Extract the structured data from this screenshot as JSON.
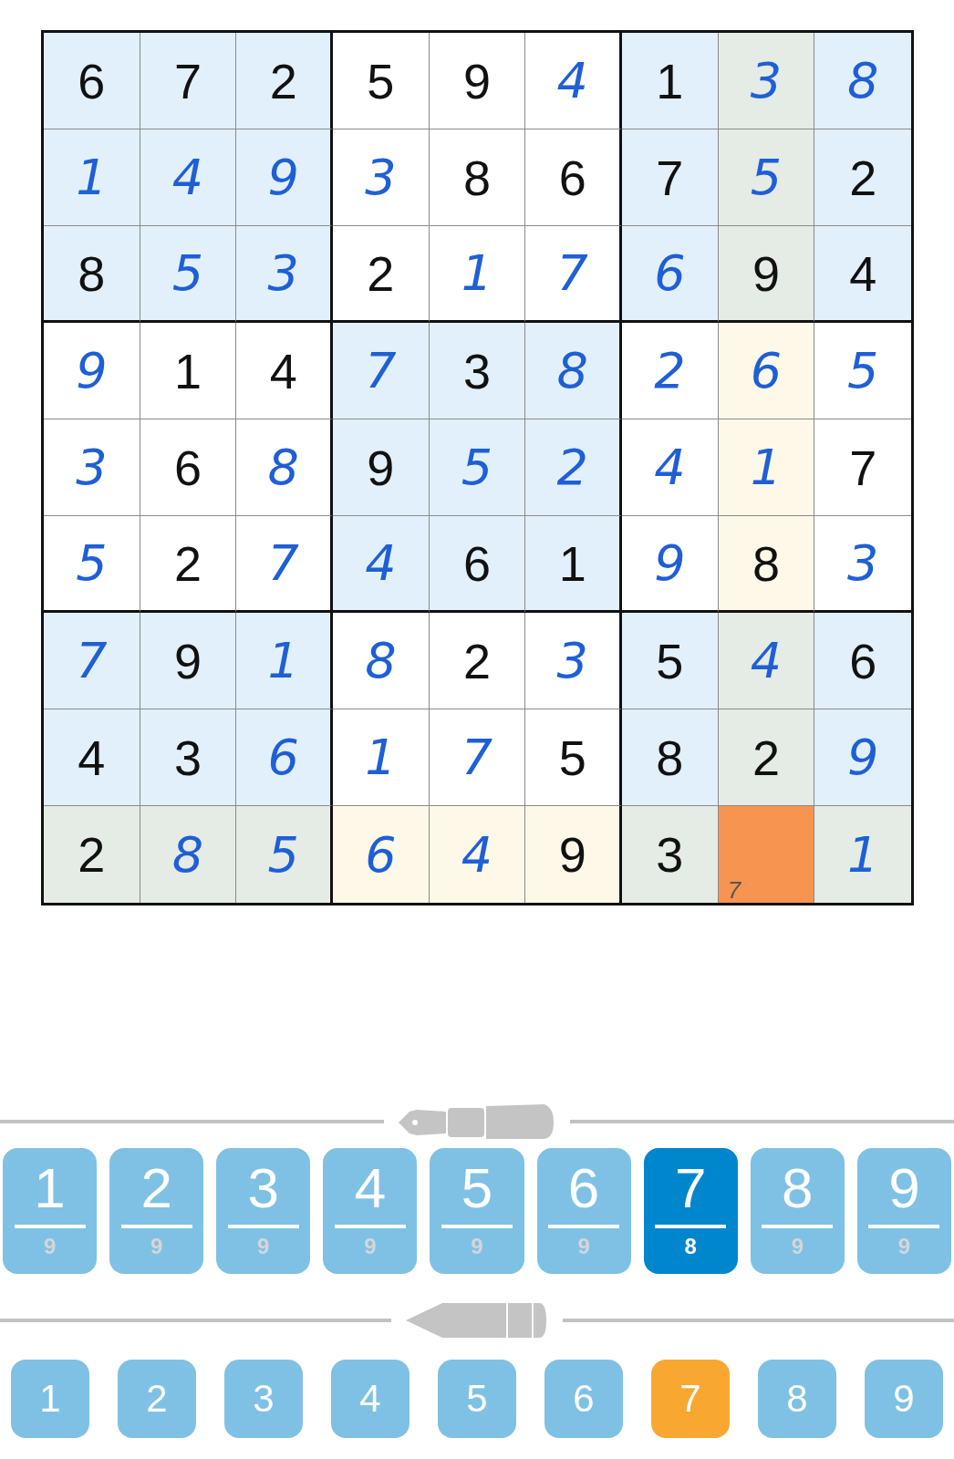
{
  "grid": [
    [
      {
        "value": "6",
        "kind": "given",
        "highlighted": false,
        "selected": false
      },
      {
        "value": "7",
        "kind": "given",
        "highlighted": false,
        "selected": false
      },
      {
        "value": "2",
        "kind": "given",
        "highlighted": false,
        "selected": false
      },
      {
        "value": "5",
        "kind": "given",
        "highlighted": false,
        "selected": false
      },
      {
        "value": "9",
        "kind": "given",
        "highlighted": false,
        "selected": false
      },
      {
        "value": "4",
        "kind": "entered",
        "highlighted": false,
        "selected": false
      },
      {
        "value": "1",
        "kind": "given",
        "highlighted": false,
        "selected": false
      },
      {
        "value": "3",
        "kind": "entered",
        "highlighted": true,
        "selected": false
      },
      {
        "value": "8",
        "kind": "entered",
        "highlighted": false,
        "selected": false
      }
    ],
    [
      {
        "value": "1",
        "kind": "entered",
        "highlighted": false,
        "selected": false
      },
      {
        "value": "4",
        "kind": "entered",
        "highlighted": false,
        "selected": false
      },
      {
        "value": "9",
        "kind": "entered",
        "highlighted": false,
        "selected": false
      },
      {
        "value": "3",
        "kind": "entered",
        "highlighted": false,
        "selected": false
      },
      {
        "value": "8",
        "kind": "given",
        "highlighted": false,
        "selected": false
      },
      {
        "value": "6",
        "kind": "given",
        "highlighted": false,
        "selected": false
      },
      {
        "value": "7",
        "kind": "given",
        "highlighted": false,
        "selected": false
      },
      {
        "value": "5",
        "kind": "entered",
        "highlighted": true,
        "selected": false
      },
      {
        "value": "2",
        "kind": "given",
        "highlighted": false,
        "selected": false
      }
    ],
    [
      {
        "value": "8",
        "kind": "given",
        "highlighted": false,
        "selected": false
      },
      {
        "value": "5",
        "kind": "entered",
        "highlighted": false,
        "selected": false
      },
      {
        "value": "3",
        "kind": "entered",
        "highlighted": false,
        "selected": false
      },
      {
        "value": "2",
        "kind": "given",
        "highlighted": false,
        "selected": false
      },
      {
        "value": "1",
        "kind": "entered",
        "highlighted": false,
        "selected": false
      },
      {
        "value": "7",
        "kind": "entered",
        "highlighted": false,
        "selected": false
      },
      {
        "value": "6",
        "kind": "entered",
        "highlighted": false,
        "selected": false
      },
      {
        "value": "9",
        "kind": "given",
        "highlighted": true,
        "selected": false
      },
      {
        "value": "4",
        "kind": "given",
        "highlighted": false,
        "selected": false
      }
    ],
    [
      {
        "value": "9",
        "kind": "entered",
        "highlighted": false,
        "selected": false
      },
      {
        "value": "1",
        "kind": "given",
        "highlighted": false,
        "selected": false
      },
      {
        "value": "4",
        "kind": "given",
        "highlighted": false,
        "selected": false
      },
      {
        "value": "7",
        "kind": "entered",
        "highlighted": false,
        "selected": false
      },
      {
        "value": "3",
        "kind": "given",
        "highlighted": false,
        "selected": false
      },
      {
        "value": "8",
        "kind": "entered",
        "highlighted": false,
        "selected": false
      },
      {
        "value": "2",
        "kind": "entered",
        "highlighted": false,
        "selected": false
      },
      {
        "value": "6",
        "kind": "entered",
        "highlighted": true,
        "selected": false
      },
      {
        "value": "5",
        "kind": "entered",
        "highlighted": false,
        "selected": false
      }
    ],
    [
      {
        "value": "3",
        "kind": "entered",
        "highlighted": false,
        "selected": false
      },
      {
        "value": "6",
        "kind": "given",
        "highlighted": false,
        "selected": false
      },
      {
        "value": "8",
        "kind": "entered",
        "highlighted": false,
        "selected": false
      },
      {
        "value": "9",
        "kind": "given",
        "highlighted": false,
        "selected": false
      },
      {
        "value": "5",
        "kind": "entered",
        "highlighted": false,
        "selected": false
      },
      {
        "value": "2",
        "kind": "entered",
        "highlighted": false,
        "selected": false
      },
      {
        "value": "4",
        "kind": "entered",
        "highlighted": false,
        "selected": false
      },
      {
        "value": "1",
        "kind": "entered",
        "highlighted": true,
        "selected": false
      },
      {
        "value": "7",
        "kind": "given",
        "highlighted": false,
        "selected": false
      }
    ],
    [
      {
        "value": "5",
        "kind": "entered",
        "highlighted": false,
        "selected": false
      },
      {
        "value": "2",
        "kind": "given",
        "highlighted": false,
        "selected": false
      },
      {
        "value": "7",
        "kind": "entered",
        "highlighted": false,
        "selected": false
      },
      {
        "value": "4",
        "kind": "entered",
        "highlighted": false,
        "selected": false
      },
      {
        "value": "6",
        "kind": "given",
        "highlighted": false,
        "selected": false
      },
      {
        "value": "1",
        "kind": "given",
        "highlighted": false,
        "selected": false
      },
      {
        "value": "9",
        "kind": "entered",
        "highlighted": false,
        "selected": false
      },
      {
        "value": "8",
        "kind": "given",
        "highlighted": true,
        "selected": false
      },
      {
        "value": "3",
        "kind": "entered",
        "highlighted": false,
        "selected": false
      }
    ],
    [
      {
        "value": "7",
        "kind": "entered",
        "highlighted": false,
        "selected": false
      },
      {
        "value": "9",
        "kind": "given",
        "highlighted": false,
        "selected": false
      },
      {
        "value": "1",
        "kind": "entered",
        "highlighted": false,
        "selected": false
      },
      {
        "value": "8",
        "kind": "entered",
        "highlighted": false,
        "selected": false
      },
      {
        "value": "2",
        "kind": "given",
        "highlighted": false,
        "selected": false
      },
      {
        "value": "3",
        "kind": "entered",
        "highlighted": false,
        "selected": false
      },
      {
        "value": "5",
        "kind": "given",
        "highlighted": false,
        "selected": false
      },
      {
        "value": "4",
        "kind": "entered",
        "highlighted": true,
        "selected": false
      },
      {
        "value": "6",
        "kind": "given",
        "highlighted": false,
        "selected": false
      }
    ],
    [
      {
        "value": "4",
        "kind": "given",
        "highlighted": false,
        "selected": false
      },
      {
        "value": "3",
        "kind": "given",
        "highlighted": false,
        "selected": false
      },
      {
        "value": "6",
        "kind": "entered",
        "highlighted": false,
        "selected": false
      },
      {
        "value": "1",
        "kind": "entered",
        "highlighted": false,
        "selected": false
      },
      {
        "value": "7",
        "kind": "entered",
        "highlighted": false,
        "selected": false
      },
      {
        "value": "5",
        "kind": "given",
        "highlighted": false,
        "selected": false
      },
      {
        "value": "8",
        "kind": "given",
        "highlighted": false,
        "selected": false
      },
      {
        "value": "2",
        "kind": "given",
        "highlighted": true,
        "selected": false
      },
      {
        "value": "9",
        "kind": "entered",
        "highlighted": false,
        "selected": false
      }
    ],
    [
      {
        "value": "2",
        "kind": "given",
        "highlighted": true,
        "selected": false
      },
      {
        "value": "8",
        "kind": "entered",
        "highlighted": true,
        "selected": false
      },
      {
        "value": "5",
        "kind": "entered",
        "highlighted": true,
        "selected": false
      },
      {
        "value": "6",
        "kind": "entered",
        "highlighted": true,
        "selected": false
      },
      {
        "value": "4",
        "kind": "entered",
        "highlighted": true,
        "selected": false
      },
      {
        "value": "9",
        "kind": "given",
        "highlighted": true,
        "selected": false
      },
      {
        "value": "3",
        "kind": "given",
        "highlighted": true,
        "selected": false
      },
      {
        "kind": "note",
        "note": "7",
        "selected": true
      },
      {
        "value": "1",
        "kind": "entered",
        "highlighted": true,
        "selected": false
      }
    ]
  ],
  "pen_buttons": [
    {
      "digit": "1",
      "count": "9",
      "selected": false
    },
    {
      "digit": "2",
      "count": "9",
      "selected": false
    },
    {
      "digit": "3",
      "count": "9",
      "selected": false
    },
    {
      "digit": "4",
      "count": "9",
      "selected": false
    },
    {
      "digit": "5",
      "count": "9",
      "selected": false
    },
    {
      "digit": "6",
      "count": "9",
      "selected": false
    },
    {
      "digit": "7",
      "count": "8",
      "selected": true
    },
    {
      "digit": "8",
      "count": "9",
      "selected": false
    },
    {
      "digit": "9",
      "count": "9",
      "selected": false
    }
  ],
  "pencil_buttons": [
    {
      "digit": "1",
      "selected": false
    },
    {
      "digit": "2",
      "selected": false
    },
    {
      "digit": "3",
      "selected": false
    },
    {
      "digit": "4",
      "selected": false
    },
    {
      "digit": "5",
      "selected": false
    },
    {
      "digit": "6",
      "selected": false
    },
    {
      "digit": "7",
      "selected": true
    },
    {
      "digit": "8",
      "selected": false
    },
    {
      "digit": "9",
      "selected": false
    }
  ]
}
